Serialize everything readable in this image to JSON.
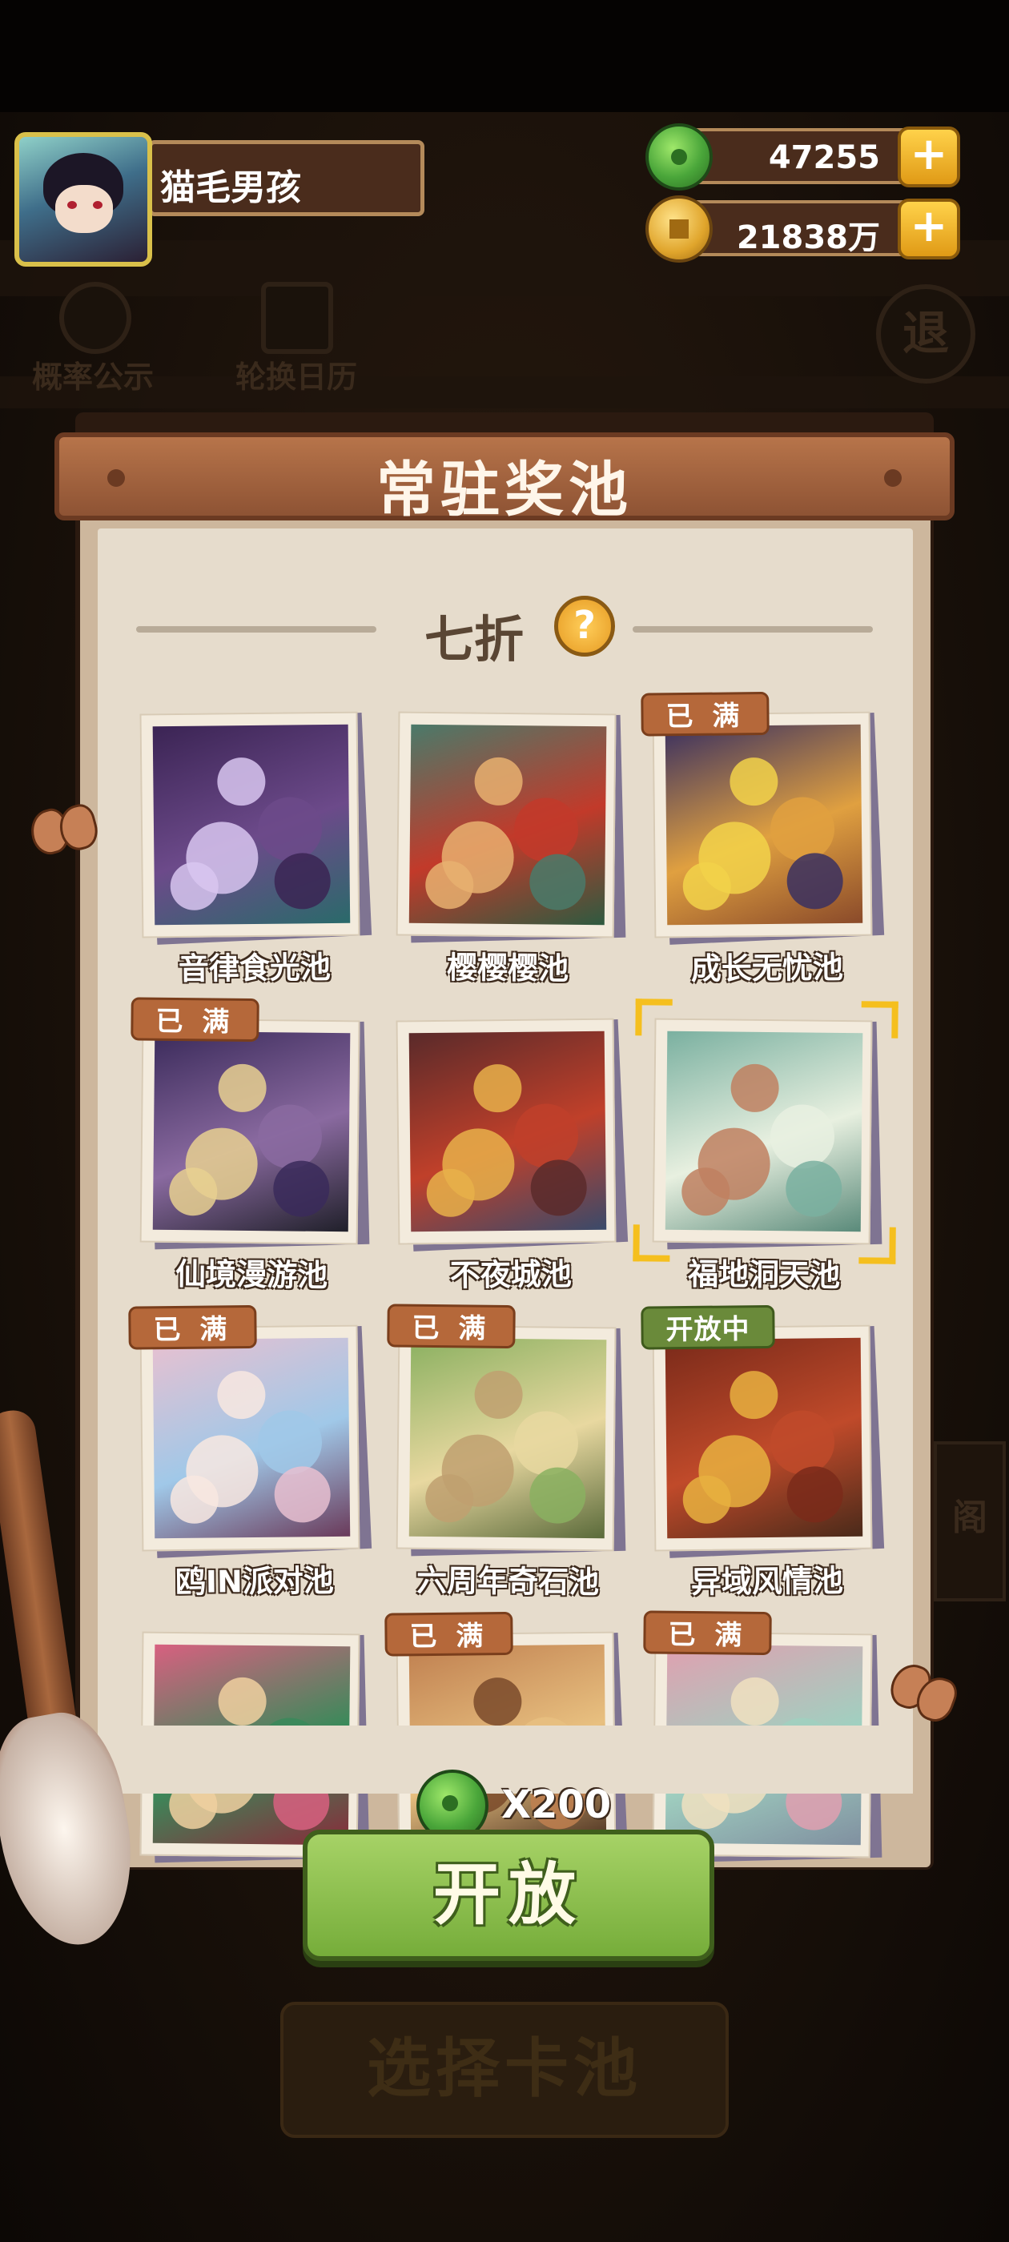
{
  "profile": {
    "name": "猫毛男孩"
  },
  "currencies": [
    {
      "icon": "jade-icon",
      "value": "47255"
    },
    {
      "icon": "coin-icon",
      "value": "21838万"
    }
  ],
  "background_menu": {
    "probability_label": "概率公示",
    "calendar_label": "轮换日历",
    "exit_label": "退",
    "shop_label": "阁",
    "choose_pool_label": "选择卡池"
  },
  "panel": {
    "title": "常驻奖池",
    "discount_text": "七折",
    "help_icon": "?"
  },
  "tags": {
    "full": "已 满",
    "open": "开放中"
  },
  "pools": [
    {
      "name": "音律食光池",
      "status": "",
      "selected": false
    },
    {
      "name": "樱樱樱池",
      "status": "",
      "selected": false
    },
    {
      "name": "成长无忧池",
      "status": "已 满",
      "selected": false
    },
    {
      "name": "仙境漫游池",
      "status": "已 满",
      "selected": false
    },
    {
      "name": "不夜城池",
      "status": "",
      "selected": false
    },
    {
      "name": "福地洞天池",
      "status": "",
      "selected": true
    },
    {
      "name": "鸥IN派对池",
      "status": "已 满",
      "selected": false
    },
    {
      "name": "六周年奇石池",
      "status": "已 满",
      "selected": false
    },
    {
      "name": "异域风情池",
      "status": "开放中",
      "selected": false
    },
    {
      "name": "",
      "status": "",
      "selected": false
    },
    {
      "name": "",
      "status": "已 满",
      "selected": false
    },
    {
      "name": "",
      "status": "已 满",
      "selected": false
    }
  ],
  "open_action": {
    "cost": "X200",
    "button_label": "开放"
  },
  "colors": {
    "accent_green": "#76ad3a",
    "banner_brown": "#8e5334",
    "tag_full": "#b5683a",
    "tag_open": "#6a8a3a",
    "selection_gold": "#f5bf1e"
  }
}
